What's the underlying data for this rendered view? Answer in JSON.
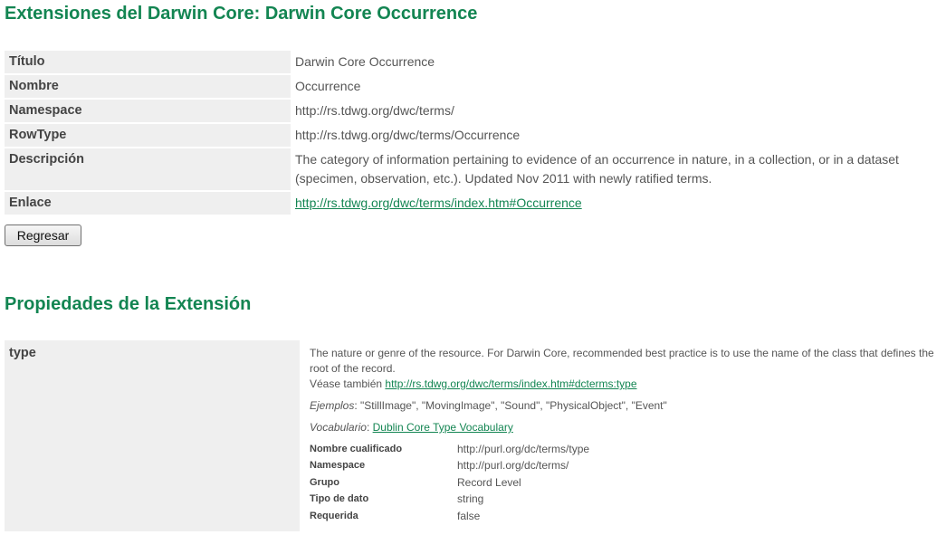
{
  "page_title": "Extensiones del Darwin Core: Darwin Core Occurrence",
  "info": [
    {
      "label": "Título",
      "value": "Darwin Core Occurrence"
    },
    {
      "label": "Nombre",
      "value": "Occurrence"
    },
    {
      "label": "Namespace",
      "value": "http://rs.tdwg.org/dwc/terms/"
    },
    {
      "label": "RowType",
      "value": "http://rs.tdwg.org/dwc/terms/Occurrence"
    },
    {
      "label": "Descripción",
      "value": "The category of information pertaining to evidence of an occurrence in nature, in a collection, or in a dataset (specimen, observation, etc.). Updated Nov 2011 with newly ratified terms."
    },
    {
      "label": "Enlace",
      "value": "http://rs.tdwg.org/dwc/terms/index.htm#Occurrence"
    }
  ],
  "back_button": "Regresar",
  "section_title": "Propiedades de la Extensión",
  "property": {
    "name": "type",
    "description": "The nature or genre of the resource. For Darwin Core, recommended best practice is to use the name of the class that defines the root of the record.",
    "see_also_label": "Véase también",
    "see_also_link": "http://rs.tdwg.org/dwc/terms/index.htm#dcterms:type",
    "examples_label": "Ejemplos",
    "examples_value": ": \"StillImage\", \"MovingImage\", \"Sound\", \"PhysicalObject\", \"Event\"",
    "vocabulary_label": "Vocabulario",
    "vocabulary_sep": ": ",
    "vocabulary_link": "Dublin Core Type Vocabulary",
    "meta": [
      {
        "key": "Nombre cualificado",
        "value": "http://purl.org/dc/terms/type"
      },
      {
        "key": "Namespace",
        "value": "http://purl.org/dc/terms/"
      },
      {
        "key": "Grupo",
        "value": "Record Level"
      },
      {
        "key": "Tipo de dato",
        "value": "string"
      },
      {
        "key": "Requerida",
        "value": "false"
      }
    ]
  },
  "colors": {
    "accent": "#138552",
    "label_bg": "#efefef"
  }
}
